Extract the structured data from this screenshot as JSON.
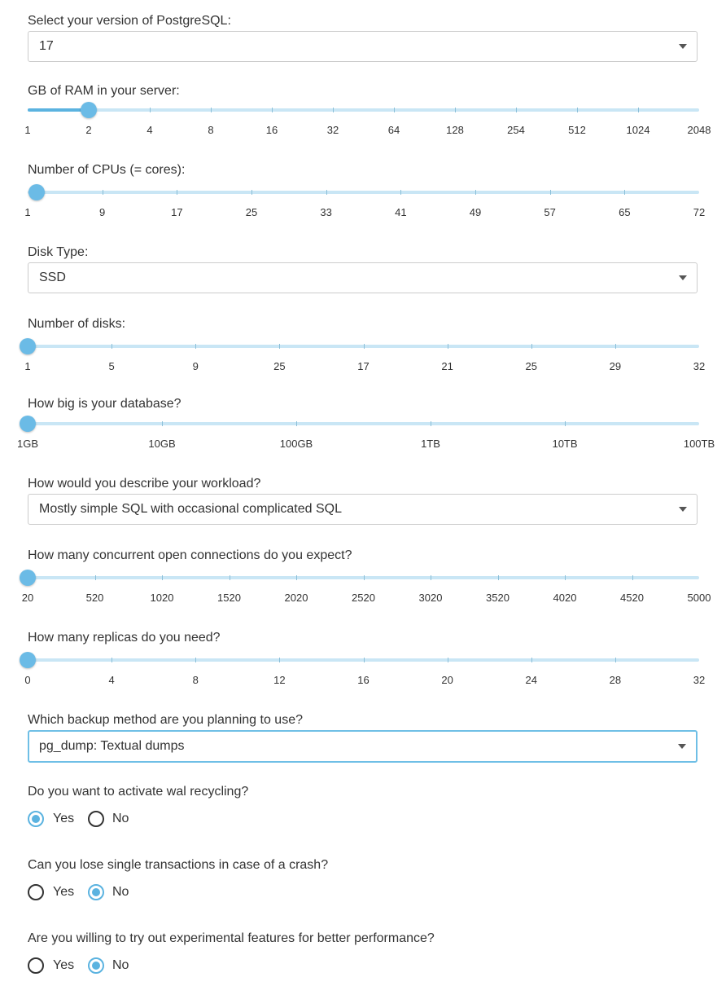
{
  "pg_version": {
    "label": "Select your version of PostgreSQL:",
    "value": "17"
  },
  "ram": {
    "label": "GB of RAM in your server:",
    "selected": "2",
    "ticks": [
      "1",
      "2",
      "4",
      "8",
      "16",
      "32",
      "64",
      "128",
      "254",
      "512",
      "1024",
      "2048"
    ]
  },
  "cpus": {
    "label": "Number of CPUs (= cores):",
    "selected": "1",
    "ticks": [
      "1",
      "9",
      "17",
      "25",
      "33",
      "41",
      "49",
      "57",
      "65",
      "72"
    ]
  },
  "disk_type": {
    "label": "Disk Type:",
    "value": "SSD"
  },
  "disks": {
    "label": "Number of disks:",
    "selected": "1",
    "ticks": [
      "1",
      "5",
      "9",
      "25",
      "17",
      "21",
      "25",
      "29",
      "32"
    ]
  },
  "db_size": {
    "label": "How big is your database?",
    "selected": "1GB",
    "ticks": [
      "1GB",
      "10GB",
      "100GB",
      "1TB",
      "10TB",
      "100TB"
    ]
  },
  "workload": {
    "label": "How would you describe your workload?",
    "value": "Mostly simple SQL with occasional complicated SQL"
  },
  "connections": {
    "label": "How many concurrent open connections do you expect?",
    "selected": "20",
    "ticks": [
      "20",
      "520",
      "1020",
      "1520",
      "2020",
      "2520",
      "3020",
      "3520",
      "4020",
      "4520",
      "5000"
    ]
  },
  "replicas": {
    "label": "How many replicas do you need?",
    "selected": "0",
    "ticks": [
      "0",
      "4",
      "8",
      "12",
      "16",
      "20",
      "24",
      "28",
      "32"
    ]
  },
  "backup": {
    "label": "Which backup method are you planning to use?",
    "value": "pg_dump: Textual dumps"
  },
  "wal_recycling": {
    "label": "Do you want to activate wal recycling?",
    "yes": "Yes",
    "no": "No",
    "selected": "Yes"
  },
  "lose_transactions": {
    "label": "Can you lose single transactions in case of a crash?",
    "yes": "Yes",
    "no": "No",
    "selected": "No"
  },
  "experimental": {
    "label": "Are you willing to try out experimental features for better performance?",
    "yes": "Yes",
    "no": "No",
    "selected": "No"
  }
}
